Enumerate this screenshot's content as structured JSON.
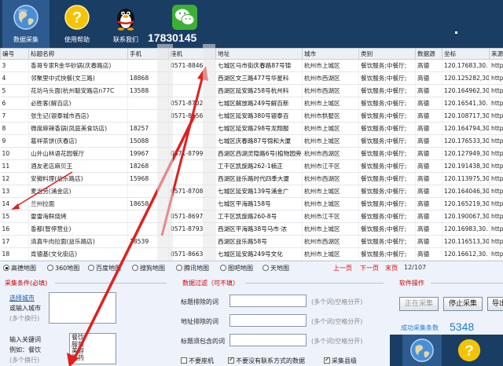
{
  "toolbar": {
    "collect_label": "数据采集",
    "help_label": "使用帮助",
    "contact_label": "联系我们",
    "qq_number": "17830145"
  },
  "table": {
    "columns": [
      "编号",
      "标题名称",
      "手机",
      "座机",
      "地址",
      "城市",
      "类别",
      "数据源",
      "坐标",
      "来源"
    ],
    "rows": [
      [
        "3",
        "香哥专家R金华砂锅(庆春路店)",
        "",
        "0571-8846",
        "七城区马市街庆春路87号锦",
        "杭州市上城区",
        "餐饮服务;中餐厅;",
        "高德",
        "120.17683,30.",
        "http"
      ],
      [
        "4",
        "邻聚里中式快餐(文三路)",
        "18868",
        "",
        "西湖区文三路477号华星科",
        "杭州市西湖区",
        "餐饮服务;中餐厅;",
        "高德",
        "120.125282,30",
        "http"
      ],
      [
        "5",
        "花坊马头面(杭州聪安路店n77C",
        "13588",
        "",
        "西湖区延安路258号杭州科",
        "杭州市西湖区",
        "餐饮服务;中餐厅;",
        "高德",
        "120.164962,30",
        "http"
      ],
      [
        "6",
        "必胜客(解百店)",
        "",
        "0571-8702",
        "七城区解放路249号解百新",
        "杭州市上城区",
        "餐饮服务;中餐厅;",
        "高德",
        "120.16541,30.",
        "http"
      ],
      [
        "7",
        "张生记(银泰城市西店)",
        "",
        "0571-8656",
        "七城区延安路380号银泰百",
        "杭州市拱墅区",
        "餐饮服务;中餐厅;",
        "高德",
        "120.108717,30",
        "http"
      ],
      [
        "8",
        "微度麻辣香锅(凤庭美食坊店)",
        "18257",
        "",
        "七城区延安路298号龙翔服",
        "杭州市上城区",
        "餐饮服务;中餐厅;",
        "高德",
        "120.164794,30",
        "http"
      ],
      [
        "9",
        "葛祥茶饼(庆春店)",
        "15088",
        "",
        "七城区庆春路87号锦和大厦",
        "杭州市上城区",
        "餐饮服务;中餐厅;",
        "高德",
        "120.176533,30",
        "http"
      ],
      [
        "10",
        "山外山林语花园餐厅",
        "19967",
        "0571-8799",
        "西湖区西湖灵隐路6号(植物园旁",
        "杭州市西湖区",
        "餐饮服务;中餐厅;",
        "高德",
        "120.127949,30",
        "http"
      ],
      [
        "11",
        "酒友老店麻贝王",
        "18268",
        "",
        "工干区凯旋路262-1楠正",
        "杭州市江干区",
        "餐饮服务;中餐厅;",
        "高德",
        "120.191438,30",
        "http"
      ],
      [
        "12",
        "安徽料理(益乐路店)",
        "15968",
        "",
        "西湖区益乐路时代四季大厦",
        "杭州市西湖区",
        "餐饮服务;中餐厅;",
        "高德",
        "120.113975,30",
        "http"
      ],
      [
        "13",
        "麦当劳(涌金店)",
        "",
        "0571-8708",
        "七城区延安路139号涌金广",
        "杭州市上城区",
        "餐饮服务;中餐厅;",
        "高德",
        "120.164046,30",
        "http"
      ],
      [
        "14",
        "兰州拉面",
        "18658",
        "",
        "七城区平海路158号",
        "杭州市上城区",
        "餐饮服务;中餐厅;",
        "高德",
        "120.165219,30",
        "http"
      ],
      [
        "15",
        "雷雷海鲜烧烤",
        "",
        "0571-8697",
        "工干区凯旋路260-8号",
        "杭州市江干区",
        "餐饮服务;中餐厅;",
        "高德",
        "120.190067,30",
        "http"
      ],
      [
        "16",
        "香都(智停营业)",
        "",
        "0571-8793",
        "西湖区平海路38号马市·浓",
        "杭州市上城区",
        "餐饮服务;中餐厅;",
        "高德",
        "120.16983,30.",
        "http"
      ],
      [
        "17",
        "清真牛肉拉面(益乐路店)",
        "18539",
        "",
        "西湖区益乐路58号",
        "杭州市西湖区",
        "餐饮服务;中餐厅;",
        "高德",
        "120.116513,30",
        "http"
      ],
      [
        "18",
        "肯德基(文化街店)",
        "",
        "0571-8663",
        "七城区延安路249号文化",
        "杭州市上城区",
        "餐饮服务;中餐厅;",
        "高德",
        "120.16612,30.",
        "http"
      ]
    ]
  },
  "map_options": {
    "items": [
      "高德地图",
      "360地图",
      "百度地图",
      "搜狗地图",
      "腾讯地图",
      "图吧地图",
      "天地图"
    ],
    "selected": 0
  },
  "pager": {
    "prev": "上一页",
    "next": "下一页",
    "last": "末页",
    "page": "12/107"
  },
  "collect_conditions": {
    "title": "采集条件(必填)",
    "select_city_link": "选择城市",
    "city_input_label": "或输入城市",
    "per_line_hint": "(多个换行)",
    "keyword_label": "输入关键词",
    "example_label": "例如：餐饮",
    "keywords": [
      "餐饮",
      "服装",
      "美容",
      "医药"
    ]
  },
  "filter": {
    "title": "数据过滤（可不填）",
    "title_exclude_label": "标题排除的词",
    "address_exclude_label": "地址排除的词",
    "title_include_label": "标题须包含的词",
    "space_hint": "(多个词)空格分开)"
  },
  "software": {
    "title": "软件操作",
    "start_button": "正在采集",
    "stop_button": "停止采集",
    "export_button": "导出",
    "success_label": "成功采集条数",
    "success_count": "5348"
  },
  "options": {
    "no_landline": "不要座机",
    "no_contact": "不要没有联系方式的数据",
    "collect_county": "采集县级"
  },
  "colors": {
    "toolbar_bg": "#1a3d64",
    "accent_red": "#cc0000",
    "link_blue": "#1a5fb4",
    "count_blue": "#1e7ad8"
  }
}
